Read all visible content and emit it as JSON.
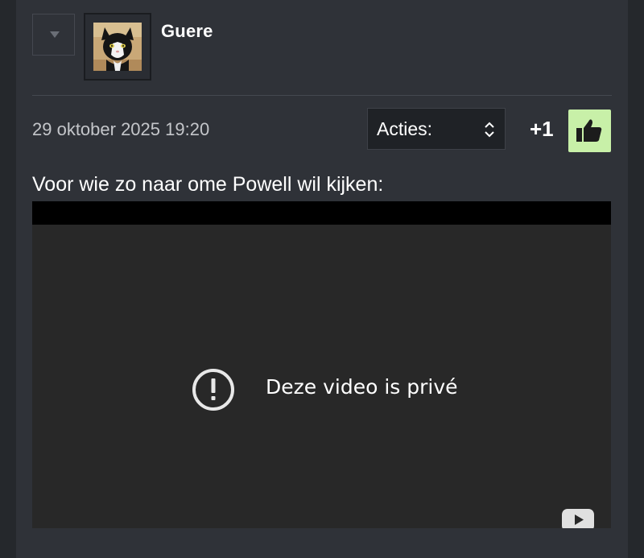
{
  "post": {
    "username": "Guere",
    "date": "29 oktober 2025 19:20",
    "actions_label": "Acties:",
    "score": "+1",
    "text": "Voor wie zo naar ome Powell wil kijken:"
  },
  "video": {
    "message": "Deze video is privé"
  },
  "icons": {
    "collapse": "triangle-down-icon",
    "avatar": "cat-avatar",
    "select": "updown-chevron-icon",
    "like": "thumbs-up-icon",
    "alert": "exclamation-circle-icon",
    "youtube": "youtube-logo-icon"
  },
  "colors": {
    "background": "#25282c",
    "panel": "#2f3238",
    "like_button": "#c8f0a8",
    "video_background": "#282828"
  }
}
